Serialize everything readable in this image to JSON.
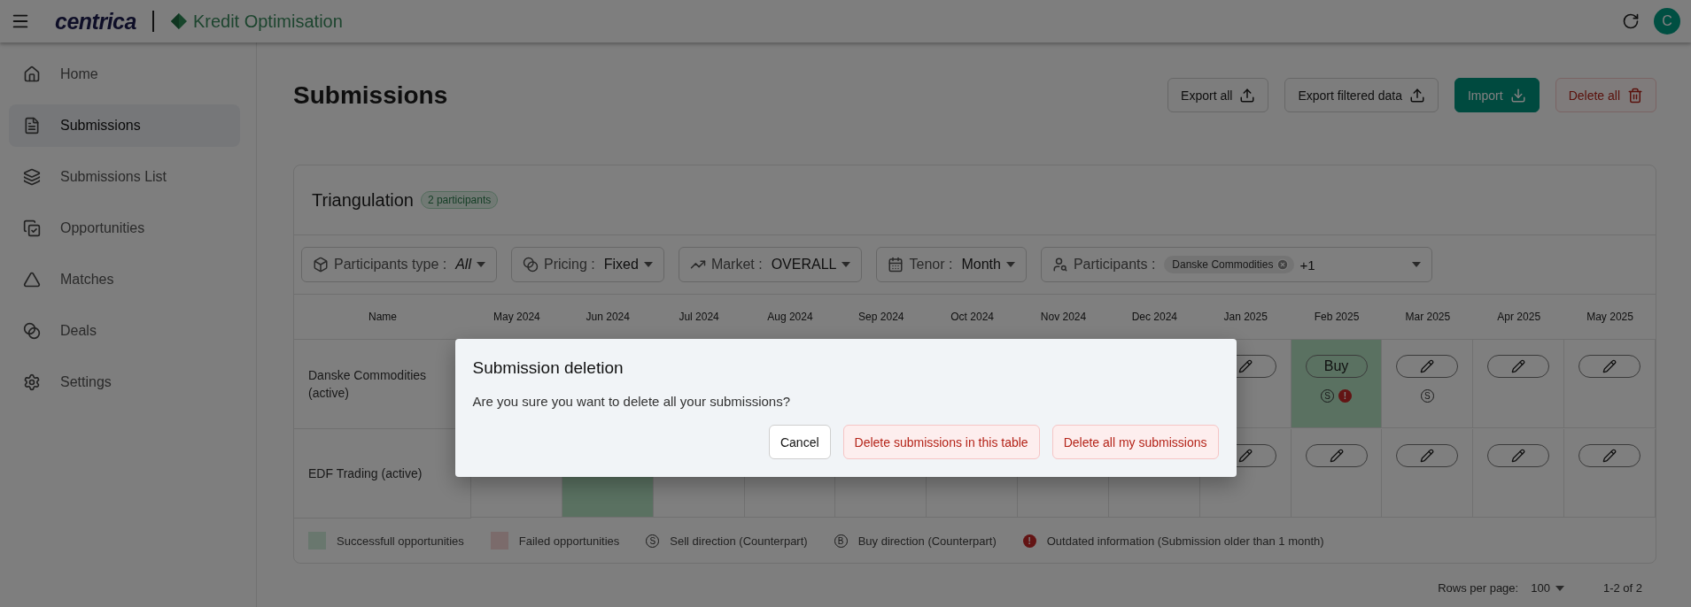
{
  "topbar": {
    "brand": "centrica",
    "product": "Kredit Optimisation",
    "avatar": "C"
  },
  "sidebar": {
    "items": [
      {
        "label": "Home",
        "selected": false
      },
      {
        "label": "Submissions",
        "selected": true
      },
      {
        "label": "Submissions List",
        "selected": false
      },
      {
        "label": "Opportunities",
        "selected": false
      },
      {
        "label": "Matches",
        "selected": false
      },
      {
        "label": "Deals",
        "selected": false
      },
      {
        "label": "Settings",
        "selected": false
      }
    ]
  },
  "page": {
    "title": "Submissions",
    "actions": [
      {
        "label": "Export all",
        "kind": "outline"
      },
      {
        "label": "Export filtered data",
        "kind": "outline"
      },
      {
        "label": "Import",
        "kind": "primary"
      },
      {
        "label": "Delete all",
        "kind": "danger"
      }
    ]
  },
  "card": {
    "title": "Triangulation",
    "badge": "2 participants",
    "filters": [
      {
        "label": "Participants type :",
        "value": "All",
        "italic": true
      },
      {
        "label": "Pricing :",
        "value": "Fixed",
        "italic": false
      },
      {
        "label": "Market :",
        "value": "OVERALL",
        "italic": false
      },
      {
        "label": "Tenor :",
        "value": "Month",
        "italic": false
      }
    ],
    "participants": {
      "label": "Participants :",
      "chip": "Danske Commodities",
      "more": "+1"
    }
  },
  "table": {
    "columns": [
      "Name",
      "May 2024",
      "Jun 2024",
      "Jul 2024",
      "Aug 2024",
      "Sep 2024",
      "Oct 2024",
      "Nov 2024",
      "Dec 2024",
      "Jan 2025",
      "Feb 2025",
      "Mar 2025",
      "Apr 2025",
      "May 2025"
    ],
    "rows": [
      {
        "cells": [
          {
            "kind": "name",
            "text": "Danske Commodities (active)"
          },
          {
            "kind": "none"
          },
          {
            "kind": "none"
          },
          {
            "kind": "none"
          },
          {
            "kind": "none"
          },
          {
            "kind": "none"
          },
          {
            "kind": "none"
          },
          {
            "kind": "none"
          },
          {
            "kind": "none"
          },
          {
            "kind": "edit",
            "success": false
          },
          {
            "kind": "buy",
            "label": "Buy",
            "success": true,
            "marks": [
              {
                "kind": "sell",
                "symbol": "S"
              },
              {
                "kind": "outdated",
                "symbol": "!"
              }
            ]
          },
          {
            "kind": "edit",
            "success": false,
            "marks": [
              {
                "kind": "sell",
                "symbol": "S"
              }
            ]
          },
          {
            "kind": "edit",
            "success": false
          },
          {
            "kind": "edit",
            "success": false
          }
        ]
      },
      {
        "cells": [
          {
            "kind": "name",
            "text": "EDF Trading (active)"
          },
          {
            "kind": "none",
            "success": false
          },
          {
            "kind": "none",
            "success": true
          },
          {
            "kind": "none",
            "success": false
          },
          {
            "kind": "none",
            "success": false
          },
          {
            "kind": "none",
            "success": false
          },
          {
            "kind": "none",
            "success": false
          },
          {
            "kind": "none",
            "success": false
          },
          {
            "kind": "none",
            "success": false
          },
          {
            "kind": "edit",
            "success": false
          },
          {
            "kind": "edit",
            "success": false
          },
          {
            "kind": "edit",
            "success": false
          },
          {
            "kind": "edit",
            "success": false
          },
          {
            "kind": "edit",
            "success": false
          }
        ]
      }
    ]
  },
  "legend": [
    {
      "kind": "swatch",
      "color": "#69776e",
      "label": "Successfull opportunities"
    },
    {
      "kind": "swatch",
      "color": "#7b6b6b",
      "label": "Failed opportunities"
    },
    {
      "kind": "sell",
      "symbol": "S",
      "label": "Sell direction (Counterpart)"
    },
    {
      "kind": "buy",
      "symbol": "B",
      "label": "Buy direction (Counterpart)"
    },
    {
      "kind": "outdated",
      "symbol": "!",
      "label": "Outdated information (Submission older than 1 month)"
    }
  ],
  "pagination": {
    "label": "Rows per page:",
    "value": "100",
    "range": "1-2 of 2"
  },
  "dialog": {
    "title": "Submission deletion",
    "message": "Are you sure you want to delete all your submissions?",
    "buttons": [
      {
        "label": "Cancel",
        "kind": "neutral"
      },
      {
        "label": "Delete submissions in this table",
        "kind": "danger"
      },
      {
        "label": "Delete all my submissions",
        "kind": "danger"
      }
    ]
  }
}
